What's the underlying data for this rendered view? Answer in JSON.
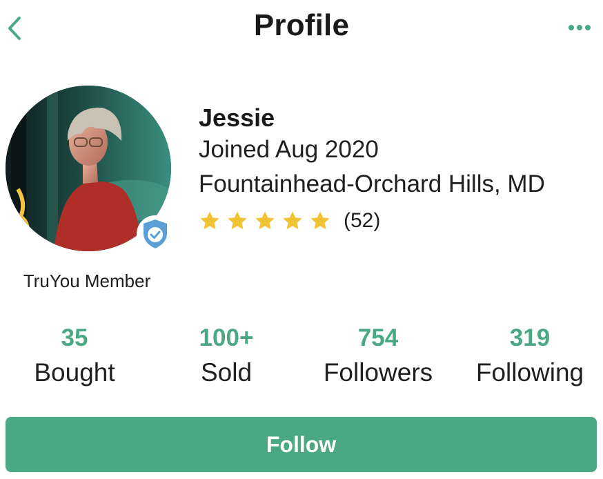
{
  "header": {
    "title": "Profile",
    "back_icon": "chevron-left-icon",
    "more_icon": "more-horizontal-icon"
  },
  "profile": {
    "name": "Jessie",
    "joined": "Joined Aug 2020",
    "location": "Fountainhead-Orchard Hills, MD",
    "rating_stars": 5,
    "rating_count": "(52)",
    "member_label": "TruYou Member",
    "verified_icon": "verified-check-icon"
  },
  "stats": [
    {
      "value": "35",
      "label": "Bought"
    },
    {
      "value": "100+",
      "label": "Sold"
    },
    {
      "value": "754",
      "label": "Followers"
    },
    {
      "value": "319",
      "label": "Following"
    }
  ],
  "actions": {
    "follow_label": "Follow"
  },
  "colors": {
    "accent": "#4aa884",
    "star": "#f2c235",
    "badge": "#5b9fd6",
    "text": "#1a1a1a"
  }
}
